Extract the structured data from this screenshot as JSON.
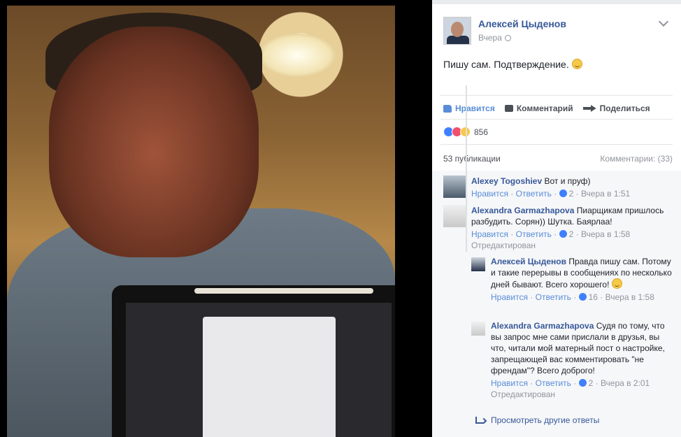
{
  "post": {
    "author": "Алексей Цыденов",
    "time": "Вчера",
    "text": "Пишу сам. Подтверждение."
  },
  "actions": {
    "like": "Нравится",
    "comment": "Комментарий",
    "share": "Поделиться"
  },
  "reactions": {
    "count": "856",
    "icons": [
      "like-icon",
      "love-icon",
      "haha-icon"
    ]
  },
  "stats": {
    "shares": "53 публикации",
    "comments": "Комментарии: (33)"
  },
  "comments": [
    {
      "name": "Alexey Togoshiev",
      "text": "Вот и пруф)",
      "like": "Нравится",
      "reply": "Ответить",
      "likes": "2",
      "time": "Вчера в 1:51"
    },
    {
      "name": "Alexandra Garmazhapova",
      "text": "Пиарщикам пришлось разбудить. Сорян)) Шутка. Баярлаа!",
      "like": "Нравится",
      "reply": "Ответить",
      "likes": "2",
      "time": "Вчера в 1:58",
      "edited": "Отредактирован"
    },
    {
      "name": "Алексей Цыденов",
      "text": "Правда пишу сам. Потому и такие перерывы в сообщениях по несколько дней бывают. Всего хорошего!",
      "like": "Нравится",
      "reply": "Ответить",
      "likes": "16",
      "time": "Вчера в 1:58"
    },
    {
      "name": "Alexandra Garmazhapova",
      "text": "Судя по тому, что вы запрос мне сами прислали в друзья, вы что, читали мой матерный пост о настройке, запрещающей вас комментировать \"не френдам\"? Всего доброго!",
      "like": "Нравится",
      "reply": "Ответить",
      "likes": "2",
      "time": "Вчера в 2:01",
      "edited": "Отредактирован"
    }
  ],
  "more_replies": "Просмотреть другие ответы",
  "colors": {
    "link": "#365899",
    "accent": "#598dd8",
    "muted": "#90949c"
  }
}
